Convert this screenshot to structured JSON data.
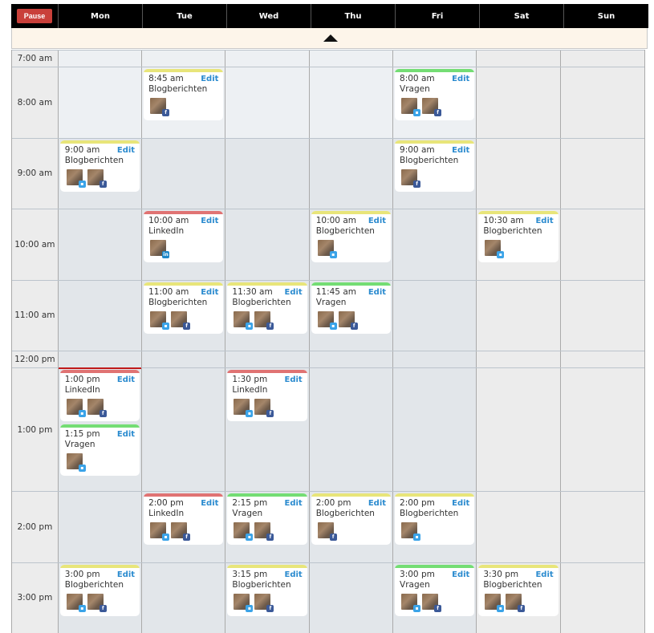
{
  "header": {
    "pause_label": "Pause",
    "days": [
      "Mon",
      "Tue",
      "Wed",
      "Thu",
      "Fri",
      "Sat",
      "Sun"
    ]
  },
  "colors": {
    "blog": "#e8e57a",
    "linkedin": "#e07373",
    "vragen": "#74dd74",
    "edit": "#2b8bcf",
    "now_line": "#c01a1a",
    "pause": "#c9403a"
  },
  "edit_label": "Edit",
  "rows": [
    {
      "time": "7:00 am",
      "kind": "short",
      "cells": [
        [],
        [],
        [],
        [],
        [],
        [],
        []
      ]
    },
    {
      "time": "8:00 am",
      "kind": "hour",
      "cells": [
        [],
        [
          {
            "time": "8:45 am",
            "label": "Blogberichten",
            "category": "blog",
            "networks": [
              "facebook"
            ]
          }
        ],
        [],
        [],
        [
          {
            "time": "8:00 am",
            "label": "Vragen",
            "category": "vragen",
            "networks": [
              "twitter",
              "facebook"
            ]
          }
        ],
        [],
        []
      ]
    },
    {
      "time": "9:00 am",
      "kind": "hour",
      "cells": [
        [
          {
            "time": "9:00 am",
            "label": "Blogberichten",
            "category": "blog",
            "networks": [
              "twitter",
              "facebook"
            ]
          }
        ],
        [],
        [],
        [],
        [
          {
            "time": "9:00 am",
            "label": "Blogberichten",
            "category": "blog",
            "networks": [
              "facebook"
            ]
          }
        ],
        [],
        []
      ]
    },
    {
      "time": "10:00 am",
      "kind": "hour",
      "cells": [
        [],
        [
          {
            "time": "10:00 am",
            "label": "LinkedIn",
            "category": "linkedin",
            "networks": [
              "linkedin"
            ]
          }
        ],
        [],
        [
          {
            "time": "10:00 am",
            "label": "Blogberichten",
            "category": "blog",
            "networks": [
              "twitter"
            ]
          }
        ],
        [],
        [
          {
            "time": "10:30 am",
            "label": "Blogberichten",
            "category": "blog",
            "networks": [
              "twitter"
            ]
          }
        ],
        []
      ]
    },
    {
      "time": "11:00 am",
      "kind": "hour",
      "cells": [
        [],
        [
          {
            "time": "11:00 am",
            "label": "Blogberichten",
            "category": "blog",
            "networks": [
              "twitter",
              "facebook"
            ]
          }
        ],
        [
          {
            "time": "11:30 am",
            "label": "Blogberichten",
            "category": "blog",
            "networks": [
              "twitter",
              "facebook"
            ]
          }
        ],
        [
          {
            "time": "11:45 am",
            "label": "Vragen",
            "category": "vragen",
            "networks": [
              "twitter",
              "facebook"
            ]
          }
        ],
        [],
        [],
        []
      ]
    },
    {
      "time": "12:00 pm",
      "kind": "short",
      "cells": [
        [],
        [],
        [],
        [],
        [],
        [],
        []
      ]
    },
    {
      "time": "1:00 pm",
      "kind": "tall",
      "now_line_day": 0,
      "cells": [
        [
          {
            "time": "1:00 pm",
            "label": "LinkedIn",
            "category": "linkedin",
            "networks": [
              "twitter",
              "facebook"
            ]
          },
          {
            "time": "1:15 pm",
            "label": "Vragen",
            "category": "vragen",
            "networks": [
              "twitter"
            ]
          }
        ],
        [],
        [
          {
            "time": "1:30 pm",
            "label": "LinkedIn",
            "category": "linkedin",
            "networks": [
              "twitter",
              "facebook"
            ]
          }
        ],
        [],
        [],
        [],
        []
      ]
    },
    {
      "time": "2:00 pm",
      "kind": "hour",
      "cells": [
        [],
        [
          {
            "time": "2:00 pm",
            "label": "LinkedIn",
            "category": "linkedin",
            "networks": [
              "twitter",
              "facebook"
            ]
          }
        ],
        [
          {
            "time": "2:15 pm",
            "label": "Vragen",
            "category": "vragen",
            "networks": [
              "twitter",
              "facebook"
            ]
          }
        ],
        [
          {
            "time": "2:00 pm",
            "label": "Blogberichten",
            "category": "blog",
            "networks": [
              "facebook"
            ]
          }
        ],
        [
          {
            "time": "2:00 pm",
            "label": "Blogberichten",
            "category": "blog",
            "networks": [
              "twitter"
            ]
          }
        ],
        [],
        []
      ]
    },
    {
      "time": "3:00 pm",
      "kind": "hour",
      "cells": [
        [
          {
            "time": "3:00 pm",
            "label": "Blogberichten",
            "category": "blog",
            "networks": [
              "twitter",
              "facebook"
            ]
          }
        ],
        [],
        [
          {
            "time": "3:15 pm",
            "label": "Blogberichten",
            "category": "blog",
            "networks": [
              "twitter",
              "facebook"
            ]
          }
        ],
        [],
        [
          {
            "time": "3:00 pm",
            "label": "Vragen",
            "category": "vragen",
            "networks": [
              "twitter",
              "facebook"
            ]
          }
        ],
        [
          {
            "time": "3:30 pm",
            "label": "Blogberichten",
            "category": "blog",
            "networks": [
              "twitter",
              "facebook"
            ]
          }
        ],
        []
      ]
    }
  ]
}
